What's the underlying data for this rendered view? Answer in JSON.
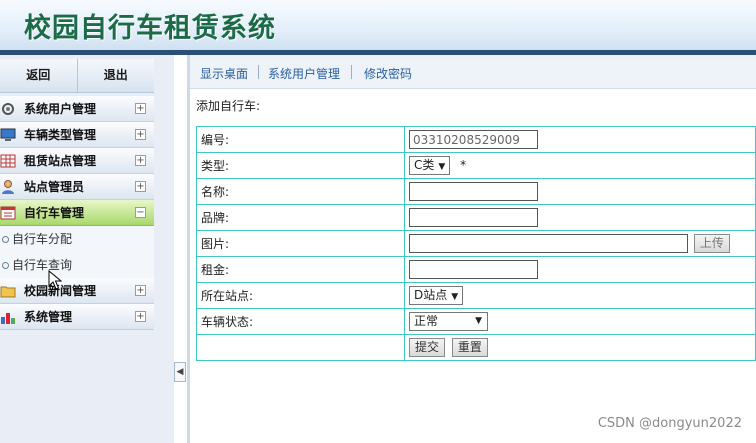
{
  "header": {
    "title": "校园自行车租赁系统"
  },
  "sidebar": {
    "top_buttons": [
      "返回",
      "退出"
    ],
    "menu": [
      {
        "label": "系统用户管理",
        "icon": "gear-icon",
        "state": "+"
      },
      {
        "label": "车辆类型管理",
        "icon": "monitor-icon",
        "state": "+"
      },
      {
        "label": "租赁站点管理",
        "icon": "grid-icon",
        "state": "+"
      },
      {
        "label": "站点管理员",
        "icon": "user-icon",
        "state": "+"
      },
      {
        "label": "自行车管理",
        "icon": "calendar-icon",
        "state": "−",
        "children": [
          "自行车分配",
          "自行车查询"
        ]
      },
      {
        "label": "校园新闻管理",
        "icon": "folder-icon",
        "state": "+"
      },
      {
        "label": "系统管理",
        "icon": "bar-chart-icon",
        "state": "+"
      }
    ],
    "collapse_glyph": "◀"
  },
  "main": {
    "tabs": [
      "显示桌面",
      "系统用户管理",
      "修改密码"
    ],
    "form_title": "添加自行车:",
    "fields": {
      "code": {
        "label": "编号:",
        "value": "03310208529009"
      },
      "type": {
        "label": "类型:",
        "value": "C类",
        "required": "*"
      },
      "name": {
        "label": "名称:",
        "value": ""
      },
      "brand": {
        "label": "品牌:",
        "value": ""
      },
      "image": {
        "label": "图片:",
        "value": "",
        "upload_label": "上传"
      },
      "rent": {
        "label": "租金:",
        "value": ""
      },
      "station": {
        "label": "所在站点:",
        "value": "D站点"
      },
      "status": {
        "label": "车辆状态:",
        "value": "正常"
      }
    },
    "submit_label": "提交",
    "reset_label": "重置"
  },
  "watermark": "CSDN @dongyun2022",
  "colors": {
    "title": "#1c6b48",
    "header_bar": "#2b4f76",
    "table_border": "#3fc6c6",
    "active_menu": "#a8d86a",
    "tab_link": "#2a5ea0"
  }
}
